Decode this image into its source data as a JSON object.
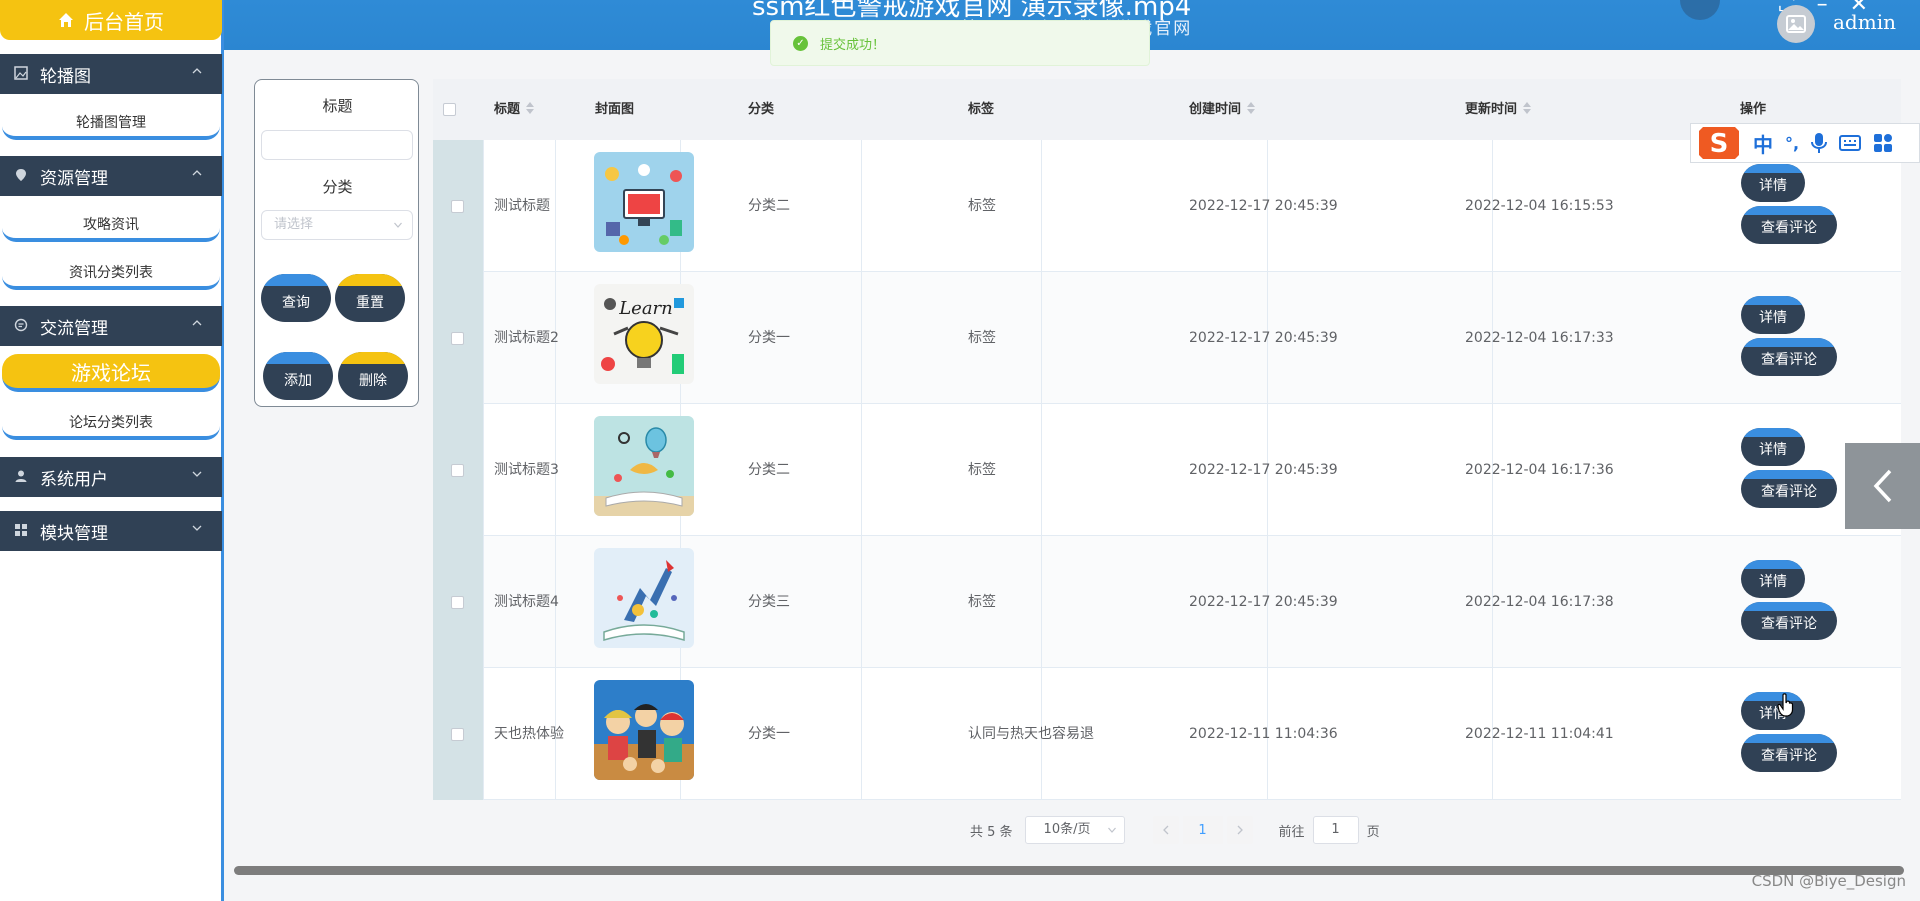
{
  "header": {
    "video_title": "ssm红色警戒游戏官网 演示录像.mp4",
    "subtitle": "基于SSM红色警戒游戏官网",
    "admin_name": "admin"
  },
  "toast": {
    "message": "提交成功！"
  },
  "sidebar": {
    "home_label": "后台首页",
    "groups": [
      {
        "label": "轮播图",
        "icon": "picture-icon",
        "items": [
          "轮播图管理"
        ]
      },
      {
        "label": "资源管理",
        "icon": "location-icon",
        "items": [
          "攻略资讯",
          "资讯分类列表"
        ]
      },
      {
        "label": "交流管理",
        "icon": "chat-icon",
        "items": [
          "游戏论坛",
          "论坛分类列表"
        ]
      },
      {
        "label": "系统用户",
        "icon": "user-icon",
        "items": []
      },
      {
        "label": "模块管理",
        "icon": "grid-icon",
        "items": []
      }
    ],
    "active_item": "游戏论坛"
  },
  "search": {
    "title_label": "标题",
    "title_value": "",
    "category_label": "分类",
    "category_placeholder": "请选择",
    "query_label": "查询",
    "reset_label": "重置",
    "add_label": "添加",
    "delete_label": "删除"
  },
  "table": {
    "columns": [
      "标题",
      "封面图",
      "分类",
      "标签",
      "创建时间",
      "更新时间",
      "操作"
    ],
    "rows": [
      {
        "title": "测试标题",
        "cover": "cover-computer",
        "category": "分类二",
        "tag": "标签",
        "created": "2022-12-17 20:45:39",
        "updated": "2022-12-04 16:15:53"
      },
      {
        "title": "测试标题2",
        "cover": "cover-learn",
        "category": "分类一",
        "tag": "标签",
        "created": "2022-12-17 20:45:39",
        "updated": "2022-12-04 16:17:33"
      },
      {
        "title": "测试标题3",
        "cover": "cover-book-balloon",
        "category": "分类二",
        "tag": "标签",
        "created": "2022-12-17 20:45:39",
        "updated": "2022-12-04 16:17:36"
      },
      {
        "title": "测试标题4",
        "cover": "cover-book-rocket",
        "category": "分类三",
        "tag": "标签",
        "created": "2022-12-17 20:45:39",
        "updated": "2022-12-04 16:17:38"
      },
      {
        "title": "天也热体验",
        "cover": "cover-anime",
        "category": "分类一",
        "tag": "认同与热天也容易退",
        "created": "2022-12-11 11:04:36",
        "updated": "2022-12-11 11:04:41"
      }
    ],
    "detail_label": "详情",
    "comment_label": "查看评论"
  },
  "pagination": {
    "total_text": "共 5 条",
    "page_size": "10条/页",
    "current_page": "1",
    "goto_prefix": "前往",
    "goto_value": "1",
    "goto_suffix": "页"
  },
  "ime": {
    "lang": "中",
    "punct": "°,"
  },
  "watermark": "CSDN @Biye_Design",
  "colors": {
    "accent_blue": "#2f8bd6",
    "dark_navy": "#304155",
    "yellow": "#f5c311",
    "success_green": "#67c23a"
  }
}
